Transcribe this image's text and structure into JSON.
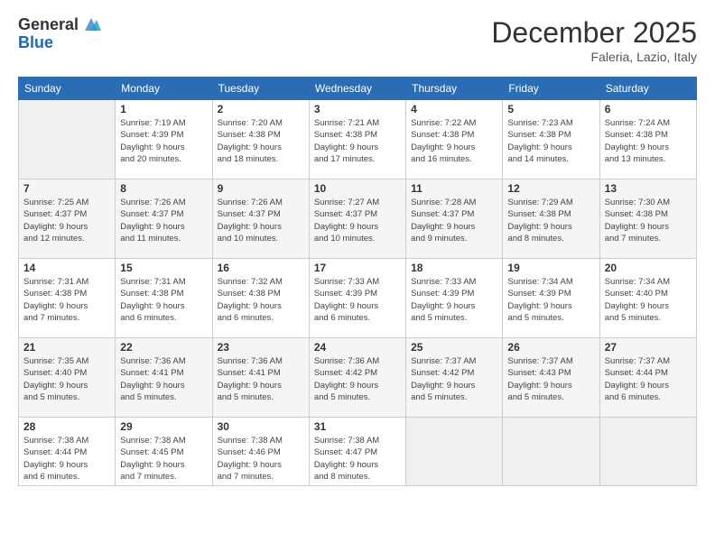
{
  "logo": {
    "general": "General",
    "blue": "Blue"
  },
  "header": {
    "month": "December 2025",
    "location": "Faleria, Lazio, Italy"
  },
  "weekdays": [
    "Sunday",
    "Monday",
    "Tuesday",
    "Wednesday",
    "Thursday",
    "Friday",
    "Saturday"
  ],
  "weeks": [
    [
      {
        "num": "",
        "info": ""
      },
      {
        "num": "1",
        "info": "Sunrise: 7:19 AM\nSunset: 4:39 PM\nDaylight: 9 hours\nand 20 minutes."
      },
      {
        "num": "2",
        "info": "Sunrise: 7:20 AM\nSunset: 4:38 PM\nDaylight: 9 hours\nand 18 minutes."
      },
      {
        "num": "3",
        "info": "Sunrise: 7:21 AM\nSunset: 4:38 PM\nDaylight: 9 hours\nand 17 minutes."
      },
      {
        "num": "4",
        "info": "Sunrise: 7:22 AM\nSunset: 4:38 PM\nDaylight: 9 hours\nand 16 minutes."
      },
      {
        "num": "5",
        "info": "Sunrise: 7:23 AM\nSunset: 4:38 PM\nDaylight: 9 hours\nand 14 minutes."
      },
      {
        "num": "6",
        "info": "Sunrise: 7:24 AM\nSunset: 4:38 PM\nDaylight: 9 hours\nand 13 minutes."
      }
    ],
    [
      {
        "num": "7",
        "info": "Sunrise: 7:25 AM\nSunset: 4:37 PM\nDaylight: 9 hours\nand 12 minutes."
      },
      {
        "num": "8",
        "info": "Sunrise: 7:26 AM\nSunset: 4:37 PM\nDaylight: 9 hours\nand 11 minutes."
      },
      {
        "num": "9",
        "info": "Sunrise: 7:26 AM\nSunset: 4:37 PM\nDaylight: 9 hours\nand 10 minutes."
      },
      {
        "num": "10",
        "info": "Sunrise: 7:27 AM\nSunset: 4:37 PM\nDaylight: 9 hours\nand 10 minutes."
      },
      {
        "num": "11",
        "info": "Sunrise: 7:28 AM\nSunset: 4:37 PM\nDaylight: 9 hours\nand 9 minutes."
      },
      {
        "num": "12",
        "info": "Sunrise: 7:29 AM\nSunset: 4:38 PM\nDaylight: 9 hours\nand 8 minutes."
      },
      {
        "num": "13",
        "info": "Sunrise: 7:30 AM\nSunset: 4:38 PM\nDaylight: 9 hours\nand 7 minutes."
      }
    ],
    [
      {
        "num": "14",
        "info": "Sunrise: 7:31 AM\nSunset: 4:38 PM\nDaylight: 9 hours\nand 7 minutes."
      },
      {
        "num": "15",
        "info": "Sunrise: 7:31 AM\nSunset: 4:38 PM\nDaylight: 9 hours\nand 6 minutes."
      },
      {
        "num": "16",
        "info": "Sunrise: 7:32 AM\nSunset: 4:38 PM\nDaylight: 9 hours\nand 6 minutes."
      },
      {
        "num": "17",
        "info": "Sunrise: 7:33 AM\nSunset: 4:39 PM\nDaylight: 9 hours\nand 6 minutes."
      },
      {
        "num": "18",
        "info": "Sunrise: 7:33 AM\nSunset: 4:39 PM\nDaylight: 9 hours\nand 5 minutes."
      },
      {
        "num": "19",
        "info": "Sunrise: 7:34 AM\nSunset: 4:39 PM\nDaylight: 9 hours\nand 5 minutes."
      },
      {
        "num": "20",
        "info": "Sunrise: 7:34 AM\nSunset: 4:40 PM\nDaylight: 9 hours\nand 5 minutes."
      }
    ],
    [
      {
        "num": "21",
        "info": "Sunrise: 7:35 AM\nSunset: 4:40 PM\nDaylight: 9 hours\nand 5 minutes."
      },
      {
        "num": "22",
        "info": "Sunrise: 7:36 AM\nSunset: 4:41 PM\nDaylight: 9 hours\nand 5 minutes."
      },
      {
        "num": "23",
        "info": "Sunrise: 7:36 AM\nSunset: 4:41 PM\nDaylight: 9 hours\nand 5 minutes."
      },
      {
        "num": "24",
        "info": "Sunrise: 7:36 AM\nSunset: 4:42 PM\nDaylight: 9 hours\nand 5 minutes."
      },
      {
        "num": "25",
        "info": "Sunrise: 7:37 AM\nSunset: 4:42 PM\nDaylight: 9 hours\nand 5 minutes."
      },
      {
        "num": "26",
        "info": "Sunrise: 7:37 AM\nSunset: 4:43 PM\nDaylight: 9 hours\nand 5 minutes."
      },
      {
        "num": "27",
        "info": "Sunrise: 7:37 AM\nSunset: 4:44 PM\nDaylight: 9 hours\nand 6 minutes."
      }
    ],
    [
      {
        "num": "28",
        "info": "Sunrise: 7:38 AM\nSunset: 4:44 PM\nDaylight: 9 hours\nand 6 minutes."
      },
      {
        "num": "29",
        "info": "Sunrise: 7:38 AM\nSunset: 4:45 PM\nDaylight: 9 hours\nand 7 minutes."
      },
      {
        "num": "30",
        "info": "Sunrise: 7:38 AM\nSunset: 4:46 PM\nDaylight: 9 hours\nand 7 minutes."
      },
      {
        "num": "31",
        "info": "Sunrise: 7:38 AM\nSunset: 4:47 PM\nDaylight: 9 hours\nand 8 minutes."
      },
      {
        "num": "",
        "info": ""
      },
      {
        "num": "",
        "info": ""
      },
      {
        "num": "",
        "info": ""
      }
    ]
  ]
}
